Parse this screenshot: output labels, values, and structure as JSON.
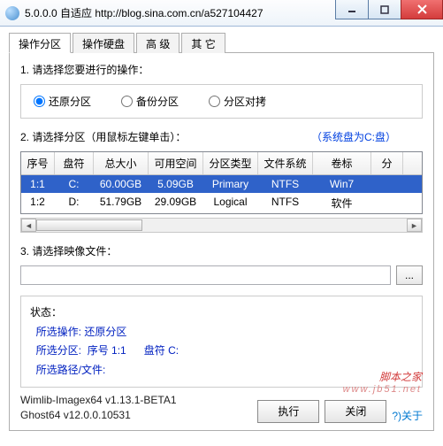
{
  "window": {
    "title": "5.0.0.0 自适应 http://blog.sina.com.cn/a527104427"
  },
  "tabs": [
    "操作分区",
    "操作硬盘",
    "高 级",
    "其 它"
  ],
  "sect1": {
    "title": "1. 请选择您要进行的操作：",
    "opts": [
      "还原分区",
      "备份分区",
      "分区对拷"
    ],
    "checked": 0
  },
  "sect2": {
    "title": "2. 请选择分区（用鼠标左键单击）：",
    "hint": "（系统盘为C:盘）",
    "cols": [
      "序号",
      "盘符",
      "总大小",
      "可用空间",
      "分区类型",
      "文件系统",
      "卷标",
      "分"
    ],
    "rows": [
      {
        "cells": [
          "1:1",
          "C:",
          "60.00GB",
          "5.09GB",
          "Primary",
          "NTFS",
          "Win7",
          ""
        ],
        "sel": true
      },
      {
        "cells": [
          "1:2",
          "D:",
          "51.79GB",
          "29.09GB",
          "Logical",
          "NTFS",
          "软件",
          ""
        ],
        "sel": false
      }
    ]
  },
  "sect3": {
    "title": "3. 请选择映像文件：",
    "value": "",
    "browse": "..."
  },
  "status": {
    "label": "状态：",
    "op_label": "所选操作:",
    "op_val": "还原分区",
    "part_label": "所选分区:",
    "part_seq_label": "序号",
    "part_seq": "1:1",
    "part_drv_label": "盘符",
    "part_drv": "C:",
    "path_label": "所选路径/文件:"
  },
  "ver": [
    "Wimlib-Imagex64 v1.13.1-BETA1",
    "Ghost64 v12.0.0.10531"
  ],
  "btn_exec": "执行",
  "btn_close": "关闭",
  "about": "?)关于",
  "wm": {
    "big": "脚本之家",
    "small": "www.jb51.net"
  }
}
